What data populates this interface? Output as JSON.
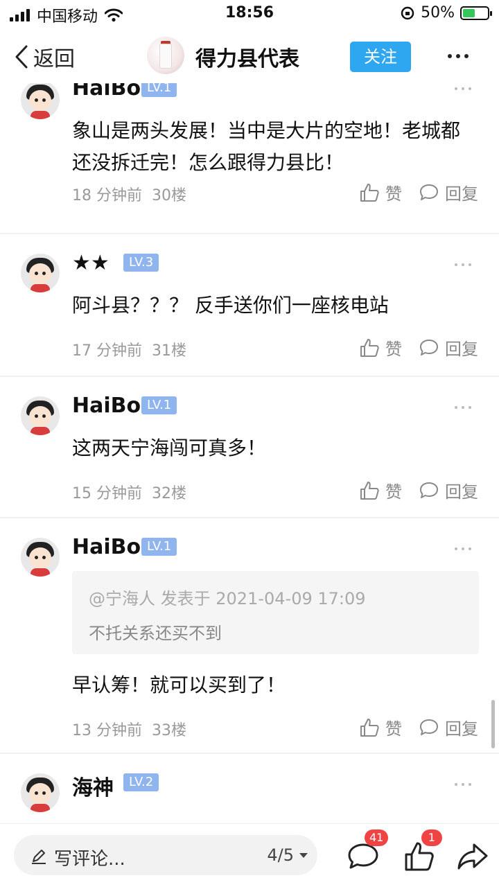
{
  "status_bar": {
    "carrier": "中国移动",
    "time": "18:56",
    "battery_percent": "50%",
    "battery_level": 0.5
  },
  "header": {
    "back_label": "返回",
    "title": "得力县代表",
    "follow_label": "关注"
  },
  "comments": [
    {
      "username": "HaiBo",
      "level": "LV.1",
      "content": "象山是两头发展！当中是大片的空地！老城都还没拆迁完！怎么跟得力县比！",
      "time": "18 分钟前",
      "floor": "30楼",
      "like_label": "赞",
      "reply_label": "回复"
    },
    {
      "username": "★★",
      "level": "LV.3",
      "content": "阿斗县？？？ 反手送你们一座核电站",
      "time": "17 分钟前",
      "floor": "31楼",
      "like_label": "赞",
      "reply_label": "回复"
    },
    {
      "username": "HaiBo",
      "level": "LV.1",
      "content": "这两天宁海闯可真多！",
      "time": "15 分钟前",
      "floor": "32楼",
      "like_label": "赞",
      "reply_label": "回复"
    },
    {
      "username": "HaiBo",
      "level": "LV.1",
      "quote_header": "@宁海人 发表于 2021-04-09 17:09",
      "quote_text": "不托关系还买不到",
      "content": "早认筹！就可以买到了！",
      "time": "13 分钟前",
      "floor": "33楼",
      "like_label": "赞",
      "reply_label": "回复"
    },
    {
      "username": "海神",
      "level": "LV.2"
    }
  ],
  "bottom_bar": {
    "input_placeholder": "写评论...",
    "page_indicator": "4/5",
    "comment_count": "41",
    "like_count": "1"
  }
}
